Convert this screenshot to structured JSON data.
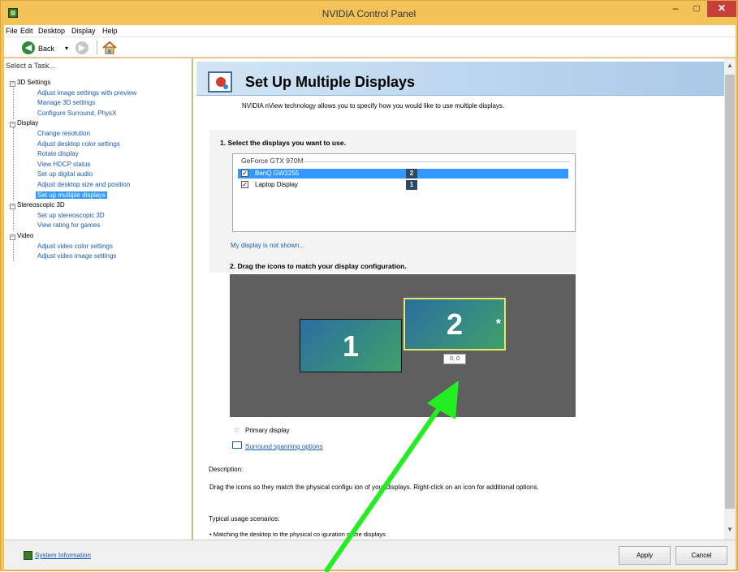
{
  "window": {
    "title": "NVIDIA Control Panel",
    "min_glyph": "–",
    "max_glyph": "□",
    "close_glyph": "✕"
  },
  "menu": [
    "File",
    "Edit",
    "Desktop",
    "Display",
    "Help"
  ],
  "toolbar": {
    "back_label": "Back",
    "back_glyph": "◀",
    "fwd_glyph": "▶",
    "dropdown_glyph": "▾"
  },
  "left_pane": {
    "header": "Select a Task...",
    "tree": [
      {
        "label": "3D Settings",
        "type": "category"
      },
      {
        "label": "Adjust image settings with preview",
        "type": "leaf"
      },
      {
        "label": "Manage 3D settings",
        "type": "leaf"
      },
      {
        "label": "Configure Surround, PhysX",
        "type": "leaf"
      },
      {
        "label": "Display",
        "type": "category"
      },
      {
        "label": "Change resolution",
        "type": "leaf"
      },
      {
        "label": "Adjust desktop color settings",
        "type": "leaf"
      },
      {
        "label": "Rotate display",
        "type": "leaf"
      },
      {
        "label": "View HDCP status",
        "type": "leaf"
      },
      {
        "label": "Set up digital audio",
        "type": "leaf"
      },
      {
        "label": "Adjust desktop size and position",
        "type": "leaf"
      },
      {
        "label": "Set up multiple displays",
        "type": "leaf",
        "selected": true
      },
      {
        "label": "Stereoscopic 3D",
        "type": "category"
      },
      {
        "label": "Set up stereoscopic 3D",
        "type": "leaf"
      },
      {
        "label": "View rating for games",
        "type": "leaf"
      },
      {
        "label": "Video",
        "type": "category"
      },
      {
        "label": "Adjust video color settings",
        "type": "leaf"
      },
      {
        "label": "Adjust video image settings",
        "type": "leaf"
      }
    ]
  },
  "main": {
    "page_title": "Set Up Multiple Displays",
    "intro": "NVIDIA nView technology allows you to specify how you would like to use multiple displays.",
    "step1": "1. Select the displays you want to use.",
    "gpu": "GeForce GTX 970M",
    "displays": [
      {
        "name": "BenQ GW2255",
        "number": "2",
        "checked": true,
        "selected": true
      },
      {
        "name": "Laptop Display",
        "number": "1",
        "checked": true,
        "selected": false
      }
    ],
    "not_shown_link": "My display is not shown...",
    "step2": "2. Drag the icons to match your display configuration.",
    "monitor1_label": "1",
    "monitor2_label": "2",
    "primary_marker": "*",
    "coordinates": "0, 0",
    "primary_display": "Primary display",
    "surround_link": "Surround spanning options",
    "description_heading": "Description:",
    "description": "Drag the icons so they match the physical configu   ion of your displays. Right-click on an icon for additional options.",
    "usage_heading": "Typical usage scenarios:",
    "usage_item": "• Matching the desktop to the physical co   iguration of the displays"
  },
  "bottom": {
    "system_info": "System Information",
    "apply": "Apply",
    "cancel": "Cancel"
  },
  "colors": {
    "title_bar": "#f3c35a",
    "selection": "#3399ff",
    "annotation_arrow": "#22ee22"
  }
}
